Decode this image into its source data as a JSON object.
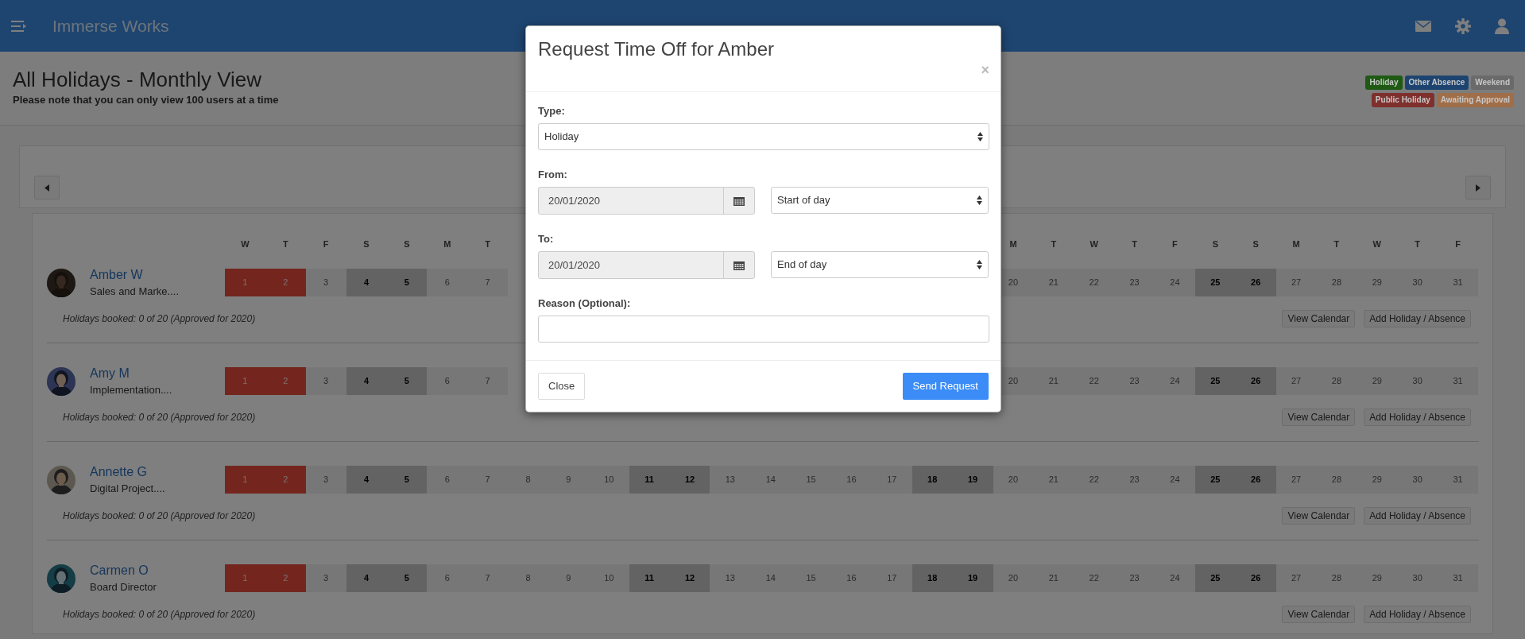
{
  "app": {
    "title": "Immerse Works"
  },
  "page": {
    "title": "All Holidays - Monthly View",
    "note": "Please note that you can only view 100 users at a time"
  },
  "legend_rows": [
    [
      {
        "label": "Holiday",
        "color": "#1f5a14"
      },
      {
        "label": "Other Absence",
        "color": "#1d4470"
      },
      {
        "label": "Weekend",
        "color": "#6a6a6a"
      }
    ],
    [
      {
        "label": "Public Holiday",
        "color": "#7f302d"
      },
      {
        "label": "Awaiting Approval",
        "color": "#a06e48"
      }
    ]
  ],
  "calendar": {
    "weekdays_before": [
      "W",
      "T",
      "F",
      "S",
      "S",
      "M",
      "T"
    ],
    "weekdays_after": [
      "M",
      "T",
      "W",
      "T",
      "F",
      "S",
      "S",
      "M",
      "T",
      "W",
      "T",
      "F"
    ],
    "rows": [
      {
        "name": "Amber W",
        "role": "Sales and Marke....",
        "booked": "Holidays booked: 0 of 20 (Approved for 2020)",
        "buttons": [
          "View Calendar",
          "Add Holiday / Absence"
        ],
        "cells_before": [
          {
            "day": "1",
            "kind": "public_holiday"
          },
          {
            "day": "2",
            "kind": "public_holiday"
          },
          {
            "day": "3",
            "kind": "workday"
          },
          {
            "day": "4",
            "kind": "weekend"
          },
          {
            "day": "5",
            "kind": "weekend"
          },
          {
            "day": "6",
            "kind": "workday"
          },
          {
            "day": "7",
            "kind": "workday"
          }
        ],
        "cells_after": [
          {
            "day": "20",
            "kind": "workday"
          },
          {
            "day": "21",
            "kind": "workday"
          },
          {
            "day": "22",
            "kind": "workday"
          },
          {
            "day": "23",
            "kind": "workday"
          },
          {
            "day": "24",
            "kind": "workday"
          },
          {
            "day": "25",
            "kind": "weekend"
          },
          {
            "day": "26",
            "kind": "weekend"
          },
          {
            "day": "27",
            "kind": "workday"
          },
          {
            "day": "28",
            "kind": "workday"
          },
          {
            "day": "29",
            "kind": "workday"
          },
          {
            "day": "30",
            "kind": "workday"
          },
          {
            "day": "31",
            "kind": "workday"
          }
        ]
      },
      {
        "name": "Amy M",
        "role": "Implementation....",
        "booked": "Holidays booked: 0 of 20 (Approved for 2020)",
        "buttons": [
          "View Calendar",
          "Add Holiday / Absence"
        ],
        "cells_before": [
          {
            "day": "1",
            "kind": "public_holiday"
          },
          {
            "day": "2",
            "kind": "public_holiday"
          },
          {
            "day": "3",
            "kind": "workday"
          },
          {
            "day": "4",
            "kind": "weekend"
          },
          {
            "day": "5",
            "kind": "weekend"
          },
          {
            "day": "6",
            "kind": "workday"
          },
          {
            "day": "7",
            "kind": "workday"
          }
        ],
        "cells_after": [
          {
            "day": "20",
            "kind": "workday"
          },
          {
            "day": "21",
            "kind": "workday"
          },
          {
            "day": "22",
            "kind": "workday"
          },
          {
            "day": "23",
            "kind": "workday"
          },
          {
            "day": "24",
            "kind": "workday"
          },
          {
            "day": "25",
            "kind": "weekend"
          },
          {
            "day": "26",
            "kind": "weekend"
          },
          {
            "day": "27",
            "kind": "workday"
          },
          {
            "day": "28",
            "kind": "workday"
          },
          {
            "day": "29",
            "kind": "workday"
          },
          {
            "day": "30",
            "kind": "workday"
          },
          {
            "day": "31",
            "kind": "workday"
          }
        ]
      },
      {
        "name": "Annette G",
        "role": "Digital Project....",
        "booked": "Holidays booked: 0 of 20 (Approved for 2020)",
        "buttons": [
          "View Calendar",
          "Add Holiday / Absence"
        ],
        "cells_before": [
          {
            "day": "1",
            "kind": "public_holiday"
          },
          {
            "day": "2",
            "kind": "public_holiday"
          },
          {
            "day": "3",
            "kind": "workday"
          },
          {
            "day": "4",
            "kind": "weekend"
          },
          {
            "day": "5",
            "kind": "weekend"
          },
          {
            "day": "6",
            "kind": "workday"
          },
          {
            "day": "7",
            "kind": "workday"
          },
          {
            "day": "8",
            "kind": "workday"
          },
          {
            "day": "9",
            "kind": "workday"
          },
          {
            "day": "10",
            "kind": "workday"
          },
          {
            "day": "11",
            "kind": "weekend"
          },
          {
            "day": "12",
            "kind": "weekend"
          },
          {
            "day": "13",
            "kind": "workday"
          },
          {
            "day": "14",
            "kind": "workday"
          },
          {
            "day": "15",
            "kind": "workday"
          },
          {
            "day": "16",
            "kind": "workday"
          },
          {
            "day": "17",
            "kind": "workday"
          },
          {
            "day": "18",
            "kind": "weekend"
          },
          {
            "day": "19",
            "kind": "weekend"
          },
          {
            "day": "20",
            "kind": "workday"
          },
          {
            "day": "21",
            "kind": "workday"
          },
          {
            "day": "22",
            "kind": "workday"
          },
          {
            "day": "23",
            "kind": "workday"
          },
          {
            "day": "24",
            "kind": "workday"
          },
          {
            "day": "25",
            "kind": "weekend"
          },
          {
            "day": "26",
            "kind": "weekend"
          },
          {
            "day": "27",
            "kind": "workday"
          },
          {
            "day": "28",
            "kind": "workday"
          },
          {
            "day": "29",
            "kind": "workday"
          },
          {
            "day": "30",
            "kind": "workday"
          },
          {
            "day": "31",
            "kind": "workday"
          }
        ]
      },
      {
        "name": "Carmen O",
        "role": "Board Director",
        "booked": "Holidays booked: 0 of 20 (Approved for 2020)",
        "buttons": [
          "View Calendar",
          "Add Holiday / Absence"
        ],
        "cells_before": [
          {
            "day": "1",
            "kind": "public_holiday"
          },
          {
            "day": "2",
            "kind": "public_holiday"
          },
          {
            "day": "3",
            "kind": "workday"
          },
          {
            "day": "4",
            "kind": "weekend"
          },
          {
            "day": "5",
            "kind": "weekend"
          },
          {
            "day": "6",
            "kind": "workday"
          },
          {
            "day": "7",
            "kind": "workday"
          },
          {
            "day": "8",
            "kind": "workday"
          },
          {
            "day": "9",
            "kind": "workday"
          },
          {
            "day": "10",
            "kind": "workday"
          },
          {
            "day": "11",
            "kind": "weekend"
          },
          {
            "day": "12",
            "kind": "weekend"
          },
          {
            "day": "13",
            "kind": "workday"
          },
          {
            "day": "14",
            "kind": "workday"
          },
          {
            "day": "15",
            "kind": "workday"
          },
          {
            "day": "16",
            "kind": "workday"
          },
          {
            "day": "17",
            "kind": "workday"
          },
          {
            "day": "18",
            "kind": "weekend"
          },
          {
            "day": "19",
            "kind": "weekend"
          },
          {
            "day": "20",
            "kind": "workday"
          },
          {
            "day": "21",
            "kind": "workday"
          },
          {
            "day": "22",
            "kind": "workday"
          },
          {
            "day": "23",
            "kind": "workday"
          },
          {
            "day": "24",
            "kind": "workday"
          },
          {
            "day": "25",
            "kind": "weekend"
          },
          {
            "day": "26",
            "kind": "weekend"
          },
          {
            "day": "27",
            "kind": "workday"
          },
          {
            "day": "28",
            "kind": "workday"
          },
          {
            "day": "29",
            "kind": "workday"
          },
          {
            "day": "30",
            "kind": "workday"
          },
          {
            "day": "31",
            "kind": "workday"
          }
        ]
      }
    ]
  },
  "dialog": {
    "title": "Request Time Off for Amber",
    "close": "×",
    "type": {
      "label": "Type:",
      "value": "Holiday"
    },
    "from": {
      "label": "From:",
      "date": "20/01/2020",
      "part": "Start of day"
    },
    "to": {
      "label": "To:",
      "date": "20/01/2020",
      "part": "End of day"
    },
    "reason": {
      "label": "Reason (Optional):"
    },
    "buttons": {
      "close": "Close",
      "submit": "Send Request"
    }
  }
}
